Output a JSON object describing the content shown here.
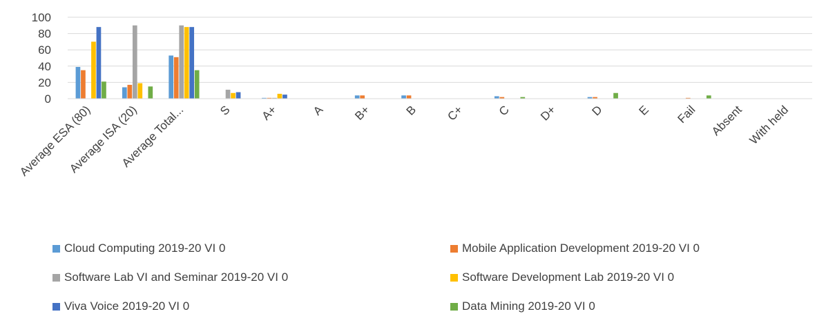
{
  "chart_data": {
    "type": "bar",
    "categories": [
      "Average ESA (80)",
      "Average ISA (20)",
      "Average Total...",
      "S",
      "A+",
      "A",
      "B+",
      "B",
      "C+",
      "C",
      "D+",
      "D",
      "E",
      "Fail",
      "Absent",
      "With held"
    ],
    "ylim": [
      0,
      100
    ],
    "yticks": [
      "0",
      "20",
      "40",
      "60",
      "80",
      "100"
    ],
    "grid": true,
    "legend_position": "bottom",
    "series": [
      {
        "name": "Cloud Computing 2019-20 VI 0",
        "color": "#5B9BD5",
        "values": [
          39,
          14,
          53,
          0,
          1,
          0,
          4,
          4,
          0,
          3,
          0,
          2,
          0,
          0,
          0,
          0
        ]
      },
      {
        "name": "Mobile Application Development 2019-20 VI 0",
        "color": "#ED7D31",
        "values": [
          35,
          17,
          51,
          0,
          1,
          0,
          4,
          4,
          0,
          2,
          0,
          2,
          0,
          1,
          0,
          0
        ]
      },
      {
        "name": "Software Lab VI and Seminar 2019-20 VI 0",
        "color": "#A5A5A5",
        "values": [
          0,
          90,
          90,
          11,
          1,
          0,
          0,
          0,
          0,
          0,
          0,
          0,
          0,
          0,
          0,
          0
        ]
      },
      {
        "name": "Software Development Lab 2019-20 VI 0",
        "color": "#FFC000",
        "values": [
          70,
          19,
          88,
          7,
          6,
          0,
          0,
          0,
          0,
          0,
          0,
          0,
          0,
          0,
          0,
          0
        ]
      },
      {
        "name": "Viva Voice 2019-20 VI 0",
        "color": "#4472C4",
        "values": [
          88,
          0,
          88,
          8,
          5,
          0,
          0,
          0,
          0,
          0,
          0,
          0,
          0,
          0,
          0,
          0
        ]
      },
      {
        "name": "Data Mining 2019-20 VI 0",
        "color": "#70AD47",
        "values": [
          21,
          15,
          35,
          0,
          0,
          0,
          0,
          0,
          0,
          2,
          0,
          7,
          0,
          4,
          0,
          0
        ]
      }
    ]
  }
}
